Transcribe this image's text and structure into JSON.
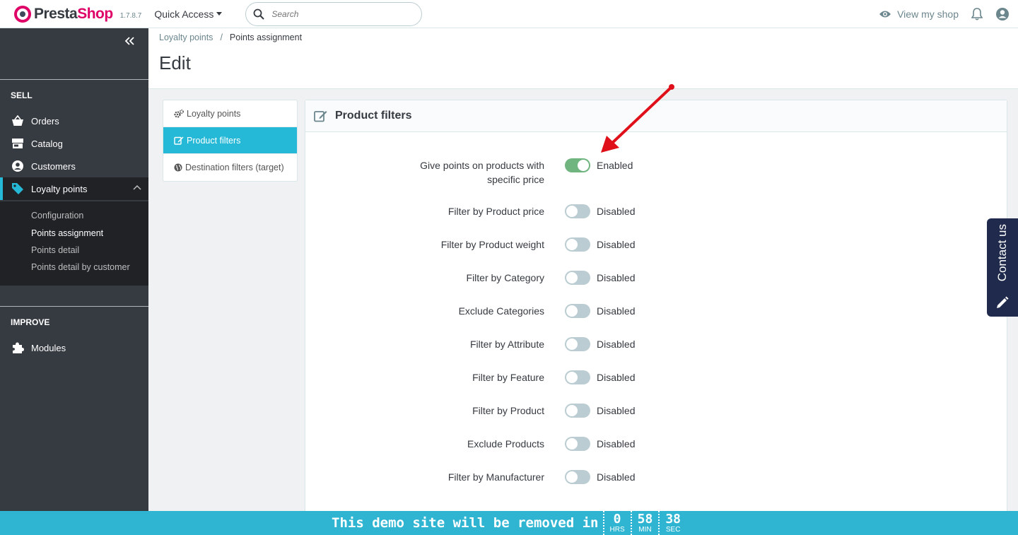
{
  "header": {
    "logo_part1": "Presta",
    "logo_part2": "Shop",
    "version": "1.7.8.7",
    "quick_access": "Quick Access",
    "search_placeholder": "Search",
    "view_shop": "View my shop"
  },
  "sidebar": {
    "sell_title": "SELL",
    "improve_title": "IMPROVE",
    "items": [
      {
        "label": "Orders",
        "icon": "basket-icon"
      },
      {
        "label": "Catalog",
        "icon": "store-icon"
      },
      {
        "label": "Customers",
        "icon": "account-icon"
      },
      {
        "label": "Loyalty points",
        "icon": "tag-icon"
      },
      {
        "label": "Modules",
        "icon": "puzzle-icon"
      }
    ],
    "submenu": [
      "Configuration",
      "Points assignment",
      "Points detail",
      "Points detail by customer"
    ]
  },
  "breadcrumb": {
    "parent": "Loyalty points",
    "separator": "/",
    "current": "Points assignment"
  },
  "page_title": "Edit",
  "tabs": [
    "Loyalty points",
    "Product filters",
    "Destination filters (target)"
  ],
  "panel": {
    "title": "Product filters",
    "rows": [
      {
        "label_line1": "Give points on products with",
        "label_line2": "specific price",
        "state": "Enabled",
        "on": true
      },
      {
        "label": "Filter by Product price",
        "state": "Disabled",
        "on": false
      },
      {
        "label": "Filter by Product weight",
        "state": "Disabled",
        "on": false
      },
      {
        "label": "Filter by Category",
        "state": "Disabled",
        "on": false
      },
      {
        "label": "Exclude Categories",
        "state": "Disabled",
        "on": false
      },
      {
        "label": "Filter by Attribute",
        "state": "Disabled",
        "on": false
      },
      {
        "label": "Filter by Feature",
        "state": "Disabled",
        "on": false
      },
      {
        "label": "Filter by Product",
        "state": "Disabled",
        "on": false
      },
      {
        "label": "Exclude Products",
        "state": "Disabled",
        "on": false
      },
      {
        "label": "Filter by Manufacturer",
        "state": "Disabled",
        "on": false
      }
    ]
  },
  "contact_tab": "Contact us",
  "demo_bar": {
    "text": "This demo site will be removed in",
    "hours": "0",
    "hours_unit": "HRS",
    "minutes": "58",
    "minutes_unit": "MIN",
    "seconds": "38",
    "seconds_unit": "SEC"
  },
  "colors": {
    "accent": "#25b9d7",
    "sidebar": "#363a41",
    "brand": "#df0067",
    "switch_on": "#70b580",
    "arrow": "#e0101a"
  }
}
